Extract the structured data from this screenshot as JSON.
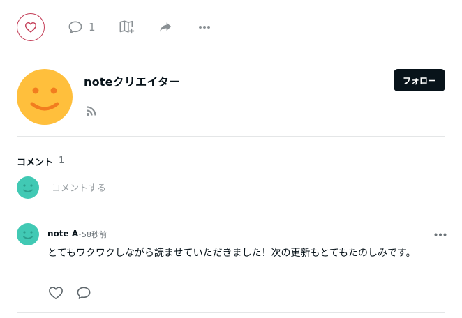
{
  "actions": {
    "comment_count": "1"
  },
  "creator": {
    "name": "noteクリエイター",
    "follow_label": "フォロー"
  },
  "comments": {
    "title": "コメント",
    "count": "1",
    "input_placeholder": "コメントする",
    "items": [
      {
        "author": "note A",
        "separator": "・",
        "time": "58秒前",
        "body": "とてもワクワクしながら読ませていただきました！次の更新もとてもたのしみです。"
      }
    ]
  },
  "colors": {
    "like_accent": "#c33b55",
    "follow_bg": "#08131a",
    "avatar_creator": "#ffbf3c",
    "avatar_user": "#41c9b4"
  },
  "icons": {
    "like": "heart-icon",
    "comment": "speech-bubble-icon",
    "magazine_add": "book-plus-icon",
    "share": "share-arrow-icon",
    "more": "more-dots-icon",
    "rss": "rss-icon",
    "avatar": "smiley-face-icon"
  }
}
